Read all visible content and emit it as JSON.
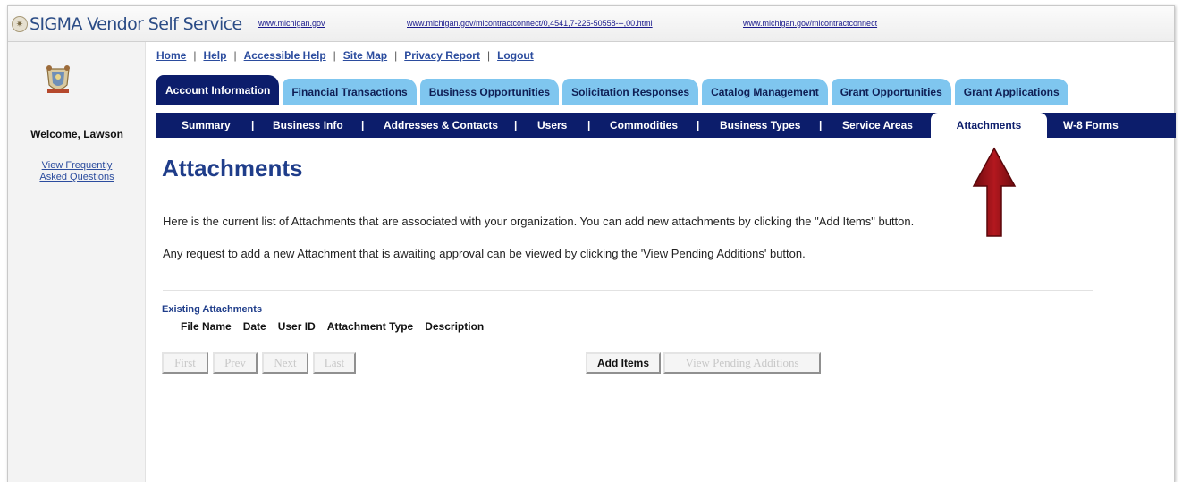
{
  "header": {
    "app_title": "SIGMA Vendor Self Service",
    "links": [
      "www.michigan.gov",
      "www.michigan.gov/micontractconnect/0,4541,7-225-50558---,00.html",
      "www.michigan.gov/micontractconnect"
    ]
  },
  "sidebar": {
    "welcome": "Welcome, Lawson",
    "faq_line1": "View Frequently",
    "faq_line2": "Asked Questions"
  },
  "utility_links": [
    "Home",
    "Help",
    "Accessible Help",
    "Site Map",
    "Privacy Report",
    "Logout"
  ],
  "tabs": [
    {
      "label": "Account Information",
      "active": true
    },
    {
      "label": "Financial Transactions"
    },
    {
      "label": "Business Opportunities"
    },
    {
      "label": "Solicitation Responses"
    },
    {
      "label": "Catalog Management"
    },
    {
      "label": "Grant Opportunities"
    },
    {
      "label": "Grant Applications"
    }
  ],
  "subnav": [
    {
      "label": "Summary"
    },
    {
      "label": "Business Info"
    },
    {
      "label": "Addresses & Contacts"
    },
    {
      "label": "Users"
    },
    {
      "label": "Commodities"
    },
    {
      "label": "Business Types"
    },
    {
      "label": "Service Areas"
    },
    {
      "label": "Attachments",
      "active": true
    },
    {
      "label": "W-8 Forms"
    }
  ],
  "main": {
    "title": "Attachments",
    "description_1": "Here is the current list of Attachments that are associated with your organization. You can add new attachments by clicking the \"Add Items\" button.",
    "description_2": "Any request to add a new Attachment that is awaiting approval can be viewed by clicking the 'View Pending Additions' button.",
    "section_label": "Existing Attachments",
    "columns": [
      "File Name",
      "Date",
      "User ID",
      "Attachment Type",
      "Description"
    ]
  },
  "buttons": {
    "first": "First",
    "prev": "Prev",
    "next": "Next",
    "last": "Last",
    "add_items": "Add Items",
    "view_pending": "View Pending Additions"
  },
  "colors": {
    "nav_dark": "#0c1d6b",
    "tab_light": "#7fc6ef",
    "link": "#2b4c9e",
    "arrow": "#8b0f14"
  },
  "icons": {
    "brand": "michigan-seal-icon",
    "annotation": "red-arrow-up-icon"
  }
}
